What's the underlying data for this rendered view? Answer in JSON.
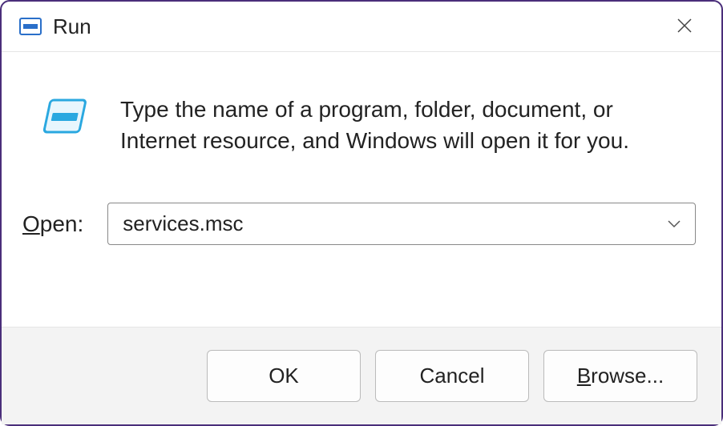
{
  "titlebar": {
    "title": "Run"
  },
  "content": {
    "description": "Type the name of a program, folder, document, or Internet resource, and Windows will open it for you.",
    "open_label_underline": "O",
    "open_label_rest": "pen:",
    "input_value": "services.msc"
  },
  "buttons": {
    "ok": "OK",
    "cancel": "Cancel",
    "browse_underline": "B",
    "browse_rest": "rowse..."
  }
}
